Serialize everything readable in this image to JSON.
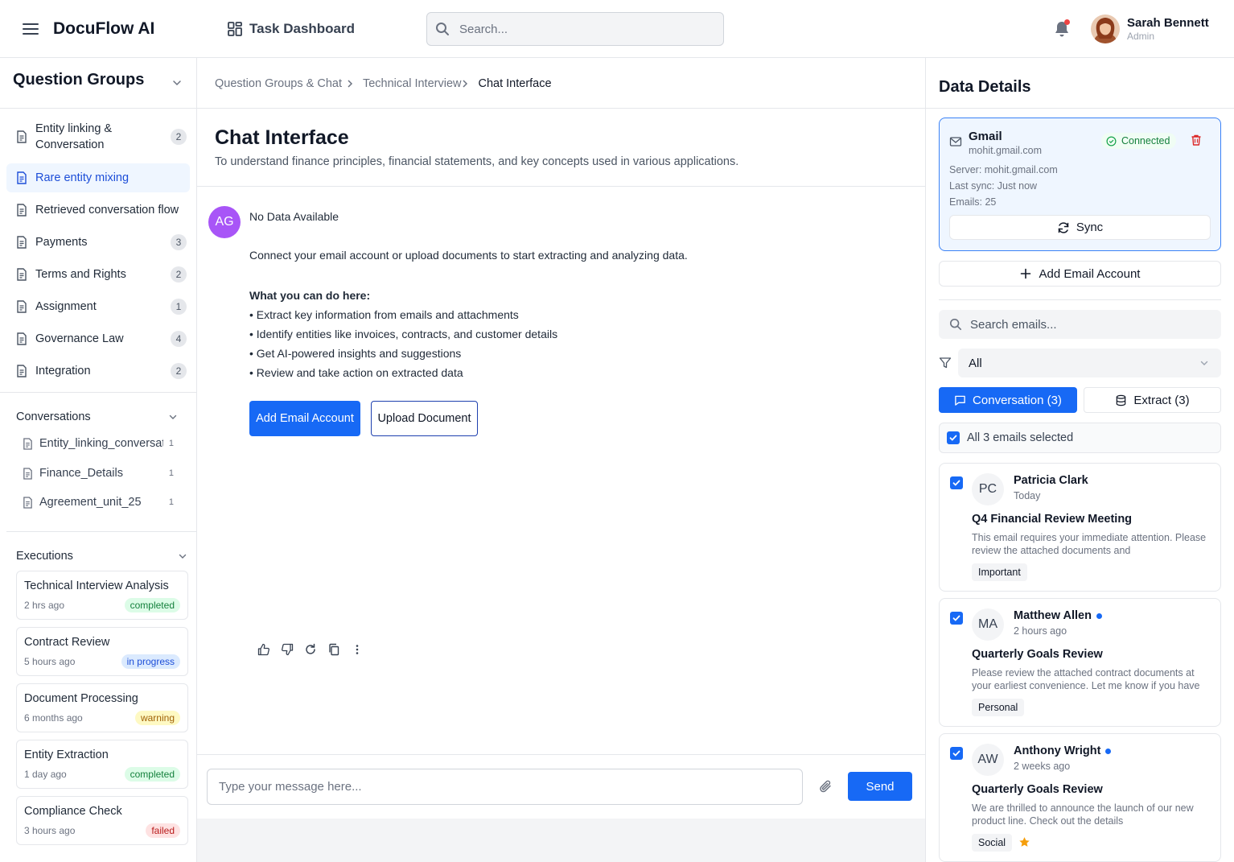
{
  "app": {
    "title": "DocuFlow AI",
    "nav_link": "Task Dashboard"
  },
  "search": {
    "placeholder": "Search..."
  },
  "user": {
    "name": "Sarah Bennett",
    "role": "Admin"
  },
  "sidebar": {
    "title": "Question Groups",
    "groups": [
      {
        "label": "Entity linking &\nConversation",
        "count": "2"
      },
      {
        "label": "Rare entity mixing",
        "count": ""
      },
      {
        "label": "Retrieved conversation flow",
        "count": ""
      },
      {
        "label": "Payments",
        "count": "3"
      },
      {
        "label": "Terms and Rights",
        "count": "2"
      },
      {
        "label": "Assignment",
        "count": "1"
      },
      {
        "label": "Governance Law",
        "count": "4"
      },
      {
        "label": "Integration",
        "count": "2"
      }
    ],
    "conversations_title": "Conversations",
    "conversations": [
      {
        "label": "Entity_linking_conversation",
        "count": "1"
      },
      {
        "label": "Finance_Details",
        "count": "1"
      },
      {
        "label": "Agreement_unit_25",
        "count": "1"
      }
    ],
    "executions_title": "Executions",
    "executions": [
      {
        "title": "Technical Interview Analysis",
        "time": "2 hrs ago",
        "status": "completed"
      },
      {
        "title": "Contract Review",
        "time": "5 hours ago",
        "status": "in progress"
      },
      {
        "title": "Document Processing",
        "time": "6 months ago",
        "status": "warning"
      },
      {
        "title": "Entity Extraction",
        "time": "1 day ago",
        "status": "completed"
      },
      {
        "title": "Compliance Check",
        "time": "3 hours ago",
        "status": "failed"
      }
    ]
  },
  "breadcrumb": {
    "items": [
      "Question Groups & Chat",
      "Technical Interview"
    ],
    "current": "Chat Interface"
  },
  "main": {
    "title": "Chat Interface",
    "subtitle": "To understand finance principles, financial statements, and key concepts used in various applications.",
    "message": {
      "avatar": "AG",
      "no_data": "No Data Available",
      "connect": "Connect your email account or upload documents to start extracting and analyzing data.",
      "can_title": "What you can do here:",
      "bullets": [
        "• Extract key information from emails and attachments",
        "• Identify entities like invoices, contracts, and customer details",
        "• Get AI-powered insights and suggestions",
        "• Review and take action on extracted data"
      ],
      "add_email_label": "Add Email Account",
      "upload_label": "Upload Document"
    },
    "composer": {
      "placeholder": "Type your message here...",
      "send_label": "Send"
    }
  },
  "details": {
    "title": "Data Details",
    "account": {
      "name": "Gmail",
      "email": "mohit.gmail.com",
      "status": "Connected",
      "server": "Server: mohit.gmail.com",
      "last_sync": "Last sync: Just now",
      "emails": "Emails: 25",
      "sync_label": "Sync"
    },
    "add_account_label": "Add Email Account",
    "search_placeholder": "Search emails...",
    "filter_value": "All",
    "tabs": {
      "conversation": "Conversation (3)",
      "extract": "Extract (3)"
    },
    "select_all_label": "All 3 emails selected",
    "emails": [
      {
        "initials": "PC",
        "sender": "Patricia Clark",
        "time": "Today",
        "subject": "Q4 Financial Review Meeting",
        "preview": "This email requires your immediate attention. Please review the attached documents and",
        "tag": "Important",
        "unread": false,
        "starred": false
      },
      {
        "initials": "MA",
        "sender": "Matthew Allen",
        "time": "2 hours ago",
        "subject": "Quarterly Goals Review",
        "preview": "Please review the attached contract documents at your earliest convenience. Let me know if you have",
        "tag": "Personal",
        "unread": true,
        "starred": false
      },
      {
        "initials": "AW",
        "sender": "Anthony Wright",
        "time": "2 weeks ago",
        "subject": "Quarterly Goals Review",
        "preview": "We are thrilled to announce the launch of our new product line. Check out the details",
        "tag": "Social",
        "unread": true,
        "starred": true
      }
    ]
  },
  "colors": {
    "accent": "#1769f5",
    "connected": "#15803d",
    "avatar_bg": "#a855f7"
  }
}
